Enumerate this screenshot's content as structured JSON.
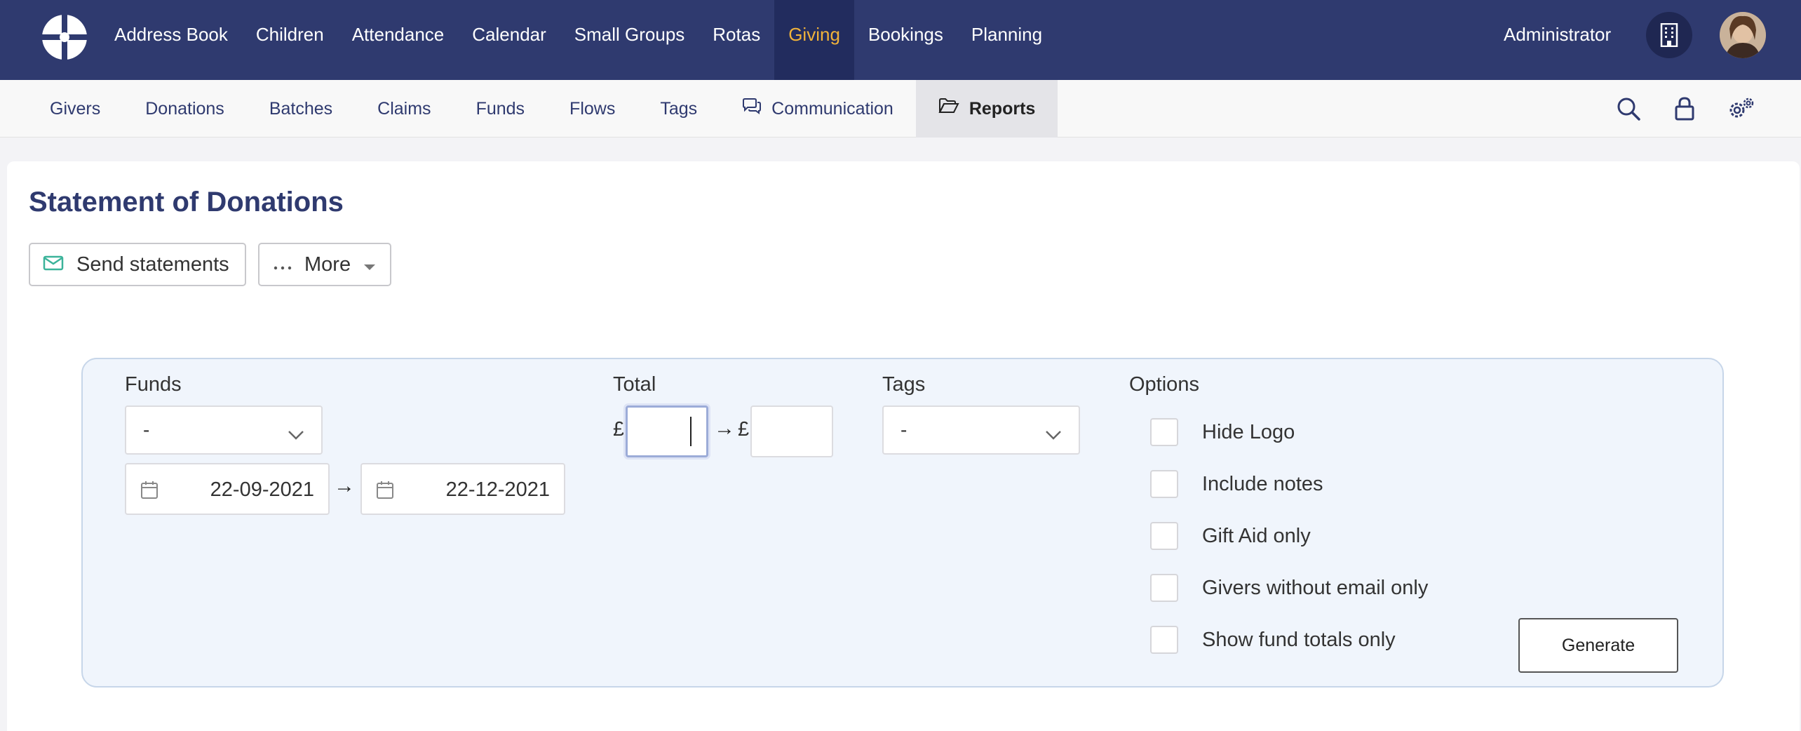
{
  "topnav": {
    "items": [
      {
        "label": "Address Book"
      },
      {
        "label": "Children"
      },
      {
        "label": "Attendance"
      },
      {
        "label": "Calendar"
      },
      {
        "label": "Small Groups"
      },
      {
        "label": "Rotas"
      },
      {
        "label": "Giving",
        "active": true
      },
      {
        "label": "Bookings"
      },
      {
        "label": "Planning"
      }
    ],
    "user": "Administrator",
    "logo_icon": "church-logo-icon",
    "org_icon": "building-icon"
  },
  "subnav": {
    "items": [
      {
        "label": "Givers"
      },
      {
        "label": "Donations"
      },
      {
        "label": "Batches"
      },
      {
        "label": "Claims"
      },
      {
        "label": "Funds"
      },
      {
        "label": "Flows"
      },
      {
        "label": "Tags"
      },
      {
        "label": "Communication",
        "icon": "chat-icon"
      },
      {
        "label": "Reports",
        "icon": "folder-open-icon",
        "active": true
      }
    ],
    "right_icons": [
      "search-icon",
      "lock-icon",
      "gear-icon"
    ]
  },
  "page": {
    "title": "Statement of Donations",
    "send_label": "Send statements",
    "more_label": "More"
  },
  "filters": {
    "funds_label": "Funds",
    "funds_value": "-",
    "date_from": "22-09-2021",
    "date_to": "22-12-2021",
    "arrow": "→",
    "total_label": "Total",
    "currency": "£",
    "total_min": "",
    "total_max": "",
    "tags_label": "Tags",
    "tags_value": "-",
    "options_label": "Options",
    "options": [
      {
        "label": "Hide Logo",
        "checked": false
      },
      {
        "label": "Include notes",
        "checked": false
      },
      {
        "label": "Gift Aid only",
        "checked": false
      },
      {
        "label": "Givers without email only",
        "checked": false
      },
      {
        "label": "Show fund totals only",
        "checked": false
      }
    ],
    "generate_label": "Generate"
  },
  "colors": {
    "nav_bg": "#2f3a6f",
    "nav_active_bg": "#222c5e",
    "nav_active_text": "#f0b23a",
    "panel_bg": "#f0f5fc",
    "panel_border": "#c7d6e9",
    "send_icon": "#3bb39a"
  }
}
